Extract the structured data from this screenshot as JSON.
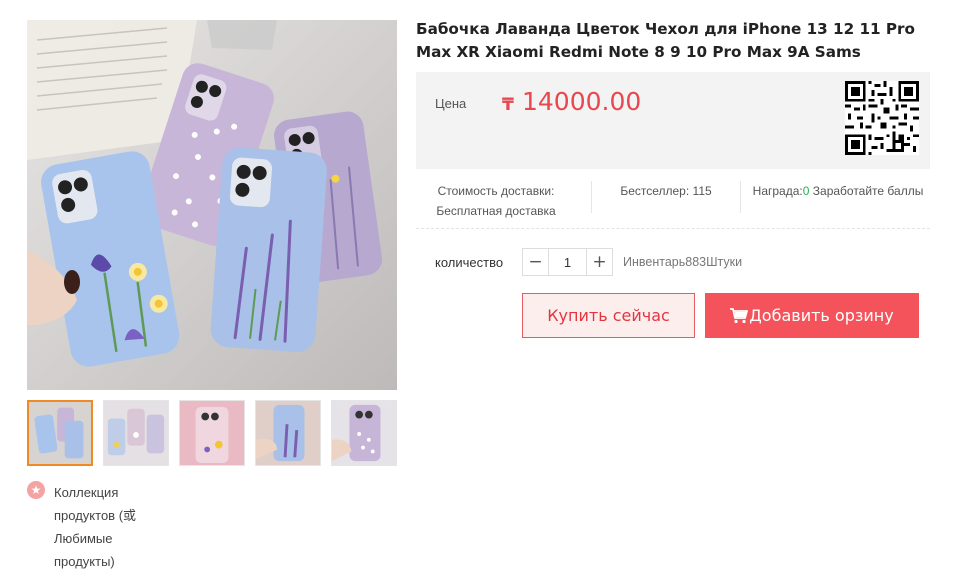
{
  "product": {
    "title": "Бабочка Лаванда Цветок Чехол для iPhone 13 12 11 Pro Max XR Xiaomi Redmi Note 8 9 10 Pro Max 9A Sams",
    "main_image": "lavender-flower-phone-cases-photo",
    "thumbnails": [
      {
        "name": "lavender-cases-thumb",
        "active": true
      },
      {
        "name": "daisy-cases-thumb",
        "active": false
      },
      {
        "name": "pink-floral-case-thumb",
        "active": false
      },
      {
        "name": "lavender-hand-thumb",
        "active": false
      },
      {
        "name": "white-flower-case-thumb",
        "active": false
      }
    ]
  },
  "favorites": {
    "icon": "star-icon",
    "label": "Коллекция продуктов (或 Любимые продукты)"
  },
  "price": {
    "label": "Цена",
    "currency": "₸",
    "value": "14000.00"
  },
  "qr_code": "qr-code-icon",
  "info": {
    "shipping_label": "Стоимость доставки:",
    "shipping_value": "Бесплатная доставка",
    "bestseller_label": "Бестселлер:",
    "bestseller_value": "115",
    "reward_label": "Награда:",
    "reward_value": "0",
    "reward_suffix": "Заработайте баллы"
  },
  "quantity": {
    "label": "количество",
    "value": "1",
    "minus": "−",
    "plus": "+",
    "inventory": "Инвентарь883Штуки"
  },
  "buttons": {
    "buy_now": "Купить сейчас",
    "add_to_cart": "Добавить орзину",
    "cart_icon": "shopping-cart-icon"
  },
  "colors": {
    "price": "#e8474f",
    "buy_border": "#e85b63",
    "cart_bg": "#f4535c",
    "reward_number": "#2bb24c",
    "active_thumb_border": "#f08a24"
  }
}
